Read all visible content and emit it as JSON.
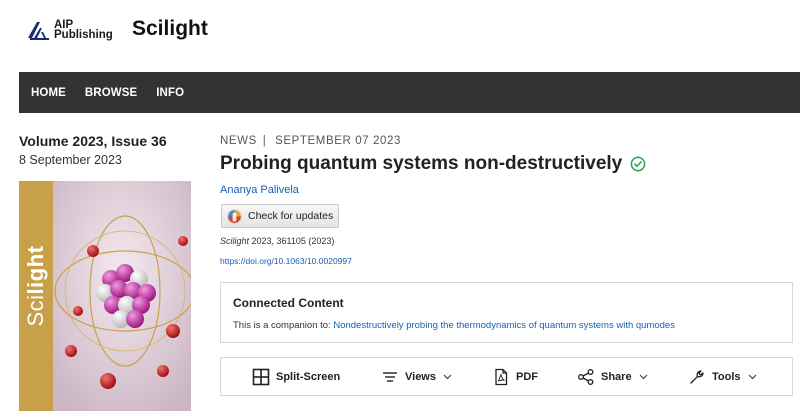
{
  "header": {
    "publisher_line1": "AIP",
    "publisher_line2": "Publishing",
    "site_title": "Scilight"
  },
  "nav": {
    "items": [
      {
        "label": "HOME"
      },
      {
        "label": "BROWSE"
      },
      {
        "label": "INFO"
      }
    ]
  },
  "issue": {
    "volume": "Volume 2023, Issue 36",
    "date": "8 September 2023",
    "cover_word_light": "Sci",
    "cover_word_bold": "light"
  },
  "article": {
    "category": "NEWS",
    "separator": "|",
    "date": "SEPTEMBER 07 2023",
    "title": "Probing quantum systems non-destructively",
    "author": "Ananya Palivela",
    "updates_label": "Check for updates",
    "citation_journal": "Scilight",
    "citation_rest": " 2023, 361105 (2023)",
    "doi": "https://doi.org/10.1063/10.0020997"
  },
  "connected": {
    "title": "Connected Content",
    "prefix": "This is a companion to: ",
    "link": "Nondestructively probing the thermodynamics of quantum systems with qumodes"
  },
  "toolbar": {
    "split_screen": "Split-Screen",
    "views": "Views",
    "pdf": "PDF",
    "share": "Share",
    "tools": "Tools"
  },
  "colors": {
    "nav_bg": "#333333",
    "link": "#1a5fb4",
    "verified": "#2e9e5b",
    "cover_band": "#c9a04a"
  },
  "icons": {
    "logo": "aip-logo-icon",
    "verified": "check-circle-icon",
    "updates": "crossmark-icon",
    "split_screen": "split-screen-icon",
    "views": "lines-icon",
    "pdf": "pdf-icon",
    "share": "share-icon",
    "tools": "wrench-icon",
    "chevron": "chevron-down-icon"
  }
}
